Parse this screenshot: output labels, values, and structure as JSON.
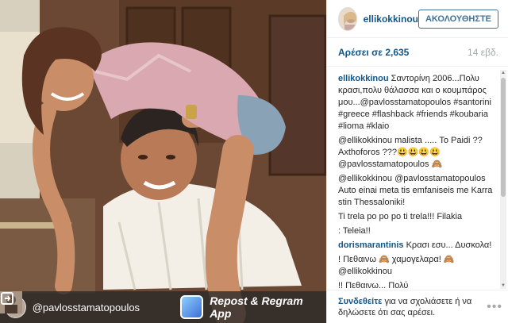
{
  "photo": {
    "regram_user": "@pavlosstamatopoulos",
    "regram_app": "Repost & Regram App"
  },
  "header": {
    "username": "ellikokkinou",
    "follow_label": "ΑΚΟΛΟΥΘΗΣΤΕ"
  },
  "stats": {
    "likes": "Αρέσει σε 2,635",
    "age": "14 εβδ."
  },
  "caption": {
    "user": "ellikokkinou",
    "text": "Σαντορίνη 2006...Πολυ κρασι,πολυ θάλασσα και ο κουμπάρος μου...@pavlosstamatopoulos #santorini #greece #flashback #friends #koubaria #lioma #klaio"
  },
  "comments": [
    {
      "user": "",
      "text": "@ellikokkinou malista ..... Το Paidi ?? Axthoforos ???😃😃😃😃 @pavlosstamatopoulos 🙈"
    },
    {
      "user": "",
      "text": "@ellikokkinou @pavlosstamatopoulos Auto einai meta tis emfaniseis me Karra stin Thessaloniki!"
    },
    {
      "user": "",
      "text": "Ti trela po po po ti trela!!! Filakia"
    },
    {
      "user": "",
      "text": ": Teleia!!"
    },
    {
      "user": "dorismarantinis",
      "text": "Κρασι εσυ... Δυσκολα!"
    },
    {
      "user": "",
      "text": "! Πεθαινω 🙈 χαμογελαρα! 🙈 @ellikokkinou"
    },
    {
      "user": "",
      "text": "!! Πεθαινω... Πολύ"
    }
  ],
  "footer": {
    "login_link": "Συνδεθείτε",
    "login_text": "για να σχολιάσετε ή να δηλώσετε ότι σας αρέσει."
  }
}
